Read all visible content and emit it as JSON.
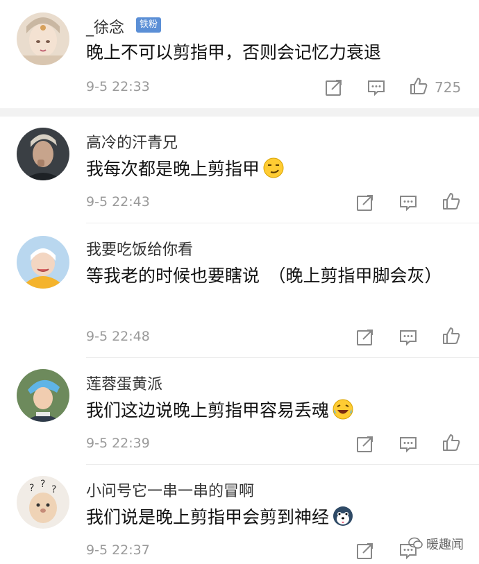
{
  "comments": [
    {
      "username": "_徐念",
      "badge": "铁粉",
      "text": "晚上不可以剪指甲，否则会记忆力衰退",
      "time": "9-5 22:33",
      "likes": "725"
    },
    {
      "username": "高冷的汗青兄",
      "text": "我每次都是晚上剪指甲",
      "emoji": "smirk-face-emoji",
      "time": "9-5 22:43"
    },
    {
      "username": "我要吃饭给你看",
      "text": "等我老的时候也要瞎说　（晚上剪指甲脚会灰）",
      "time": "9-5 22:48"
    },
    {
      "username": "莲蓉蛋黄派",
      "text": "我们这边说晚上剪指甲容易丢魂",
      "emoji": "laughing-tears-emoji",
      "time": "9-5 22:39"
    },
    {
      "username": "小问号它一串一串的冒啊",
      "text": "我们说是晚上剪指甲会剪到神经",
      "emoji": "husky-dog-emoji",
      "time": "9-5 22:37"
    }
  ],
  "actions": {
    "share_icon": "share-icon",
    "reply_icon": "comment-icon",
    "like_icon": "thumbs-up-icon"
  },
  "watermark": "暖趣闻",
  "colors": {
    "badge": "#5b8fd6",
    "meta": "#9a9a9a",
    "band": "#f2f2f2"
  }
}
